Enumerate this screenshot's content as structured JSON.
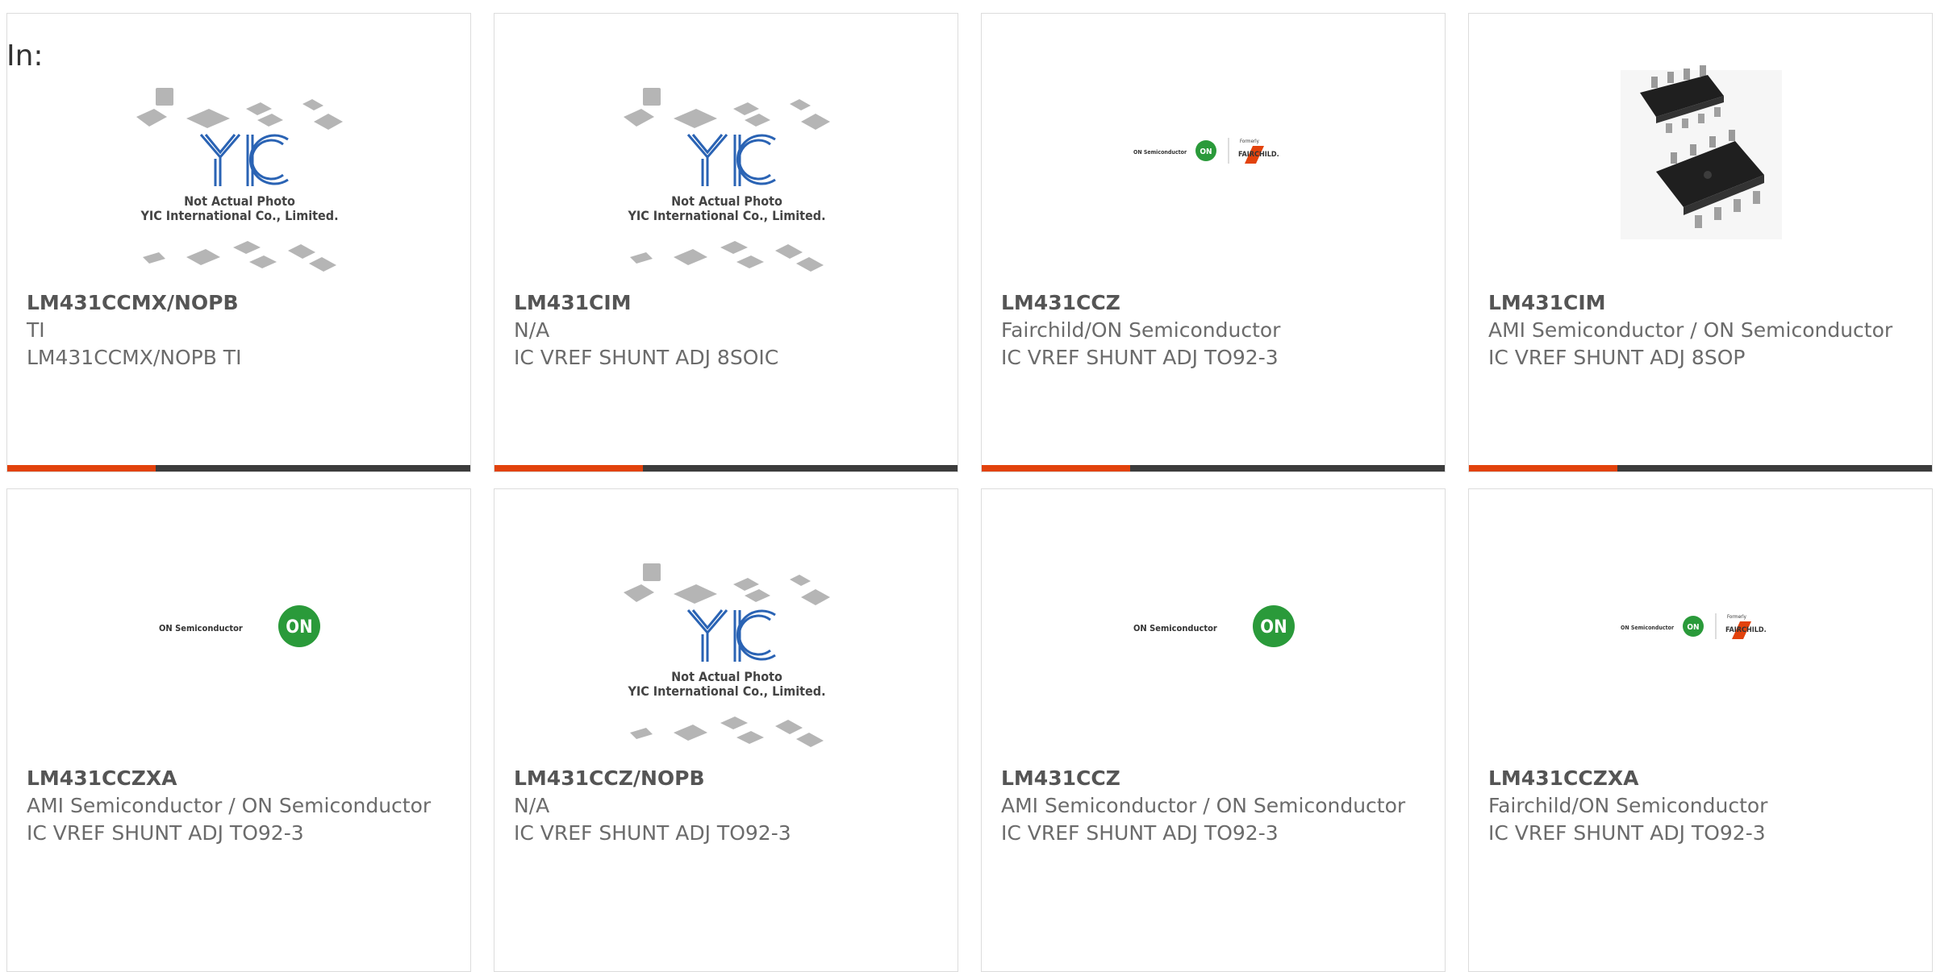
{
  "filter_label": "In:",
  "colors": {
    "accent_bar": "#e2420c",
    "bar_dark": "#3c3c3c",
    "yic_blue": "#2a63b4",
    "on_green": "#2a9a3a"
  },
  "placeholder_image": {
    "icon": "yic-placeholder-icon",
    "logo_text": "YIC",
    "line1": "Not Actual Photo",
    "line2": "YIC International Co., Limited."
  },
  "on_logo": {
    "name": "ON Semiconductor",
    "badge": "ON"
  },
  "fairchild_logo": {
    "formerly": "Formerly",
    "name": "FAIRCHILD."
  },
  "products": [
    {
      "part": "LM431CCMX/NOPB",
      "mfr": "TI",
      "desc": "LM431CCMX/NOPB TI",
      "image": "yic-placeholder"
    },
    {
      "part": "LM431CIM",
      "mfr": "N/A",
      "desc": "IC VREF SHUNT ADJ 8SOIC",
      "image": "yic-placeholder"
    },
    {
      "part": "LM431CCZ",
      "mfr": "Fairchild/ON Semiconductor",
      "desc": "IC VREF SHUNT ADJ TO92-3",
      "image": "on-fairchild-logo"
    },
    {
      "part": "LM431CIM",
      "mfr": "AMI Semiconductor / ON Semiconductor",
      "desc": "IC VREF SHUNT ADJ 8SOP",
      "image": "soic-chip-photo"
    },
    {
      "part": "LM431CCZXA",
      "mfr": "AMI Semiconductor / ON Semiconductor",
      "desc": "IC VREF SHUNT ADJ TO92-3",
      "image": "on-logo"
    },
    {
      "part": "LM431CCZ/NOPB",
      "mfr": "N/A",
      "desc": "IC VREF SHUNT ADJ TO92-3",
      "image": "yic-placeholder"
    },
    {
      "part": "LM431CCZ",
      "mfr": "AMI Semiconductor / ON Semiconductor",
      "desc": "IC VREF SHUNT ADJ TO92-3",
      "image": "on-logo"
    },
    {
      "part": "LM431CCZXA",
      "mfr": "Fairchild/ON Semiconductor",
      "desc": "IC VREF SHUNT ADJ TO92-3",
      "image": "on-fairchild-logo"
    }
  ]
}
